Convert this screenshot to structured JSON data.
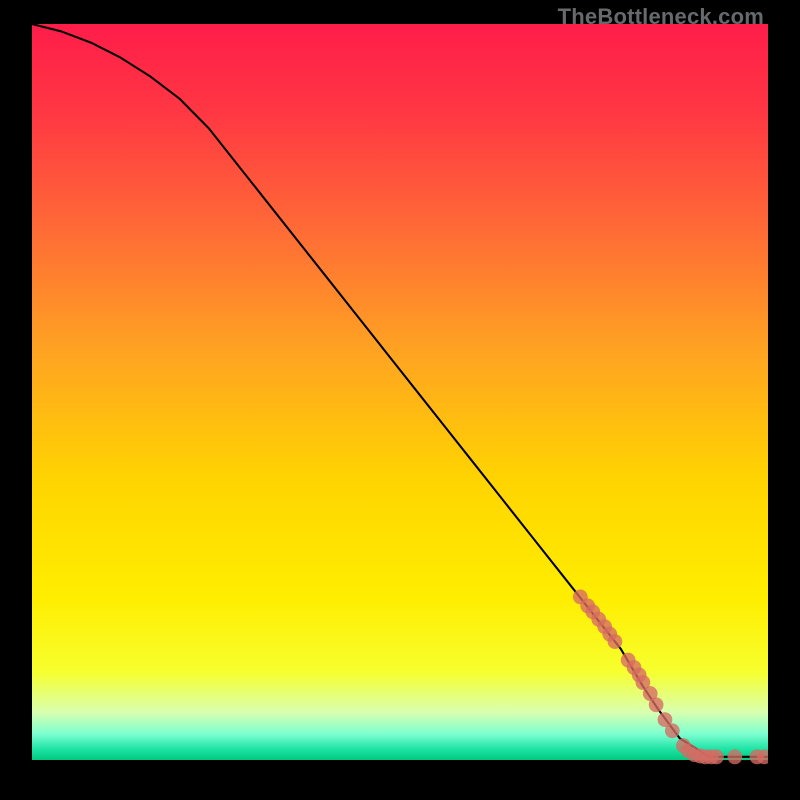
{
  "watermark": "TheBottleneck.com",
  "colors": {
    "dot": "#d66a63",
    "curve": "#000000",
    "gradient_stops": [
      {
        "offset": 0.0,
        "color": "#ff1d4a"
      },
      {
        "offset": 0.12,
        "color": "#ff3743"
      },
      {
        "offset": 0.28,
        "color": "#ff6b36"
      },
      {
        "offset": 0.45,
        "color": "#ffa521"
      },
      {
        "offset": 0.62,
        "color": "#ffd400"
      },
      {
        "offset": 0.78,
        "color": "#ffee00"
      },
      {
        "offset": 0.88,
        "color": "#f7ff2e"
      },
      {
        "offset": 0.935,
        "color": "#d9ffb0"
      },
      {
        "offset": 0.965,
        "color": "#7cffd0"
      },
      {
        "offset": 0.985,
        "color": "#1ee3a5"
      },
      {
        "offset": 1.0,
        "color": "#00c97e"
      }
    ]
  },
  "chart_data": {
    "type": "line",
    "title": "",
    "xlabel": "",
    "ylabel": "",
    "xlim": [
      0,
      100
    ],
    "ylim": [
      0,
      100
    ],
    "series": [
      {
        "name": "curve",
        "x": [
          0,
          4,
          8,
          12,
          16,
          20,
          24,
          28,
          32,
          36,
          40,
          44,
          48,
          52,
          56,
          60,
          64,
          68,
          72,
          76,
          80,
          83,
          85,
          88,
          92,
          96,
          100
        ],
        "y": [
          100,
          99,
          97.5,
          95.5,
          93,
          90,
          86,
          81,
          76,
          71,
          66,
          61,
          56,
          51,
          46,
          41,
          36,
          31,
          26,
          21,
          16,
          11,
          8,
          4,
          1.5,
          1.5,
          1.5
        ]
      }
    ],
    "markers": [
      {
        "x": 74.5,
        "y": 23,
        "r": 1.0
      },
      {
        "x": 75.5,
        "y": 21.8,
        "r": 1.0
      },
      {
        "x": 76.2,
        "y": 21,
        "r": 1.0
      },
      {
        "x": 77.0,
        "y": 20,
        "r": 1.0
      },
      {
        "x": 77.8,
        "y": 19,
        "r": 1.0
      },
      {
        "x": 78.5,
        "y": 18,
        "r": 1.0
      },
      {
        "x": 79.2,
        "y": 17,
        "r": 1.0
      },
      {
        "x": 81.0,
        "y": 14.5,
        "r": 1.0
      },
      {
        "x": 81.8,
        "y": 13.5,
        "r": 1.0
      },
      {
        "x": 82.5,
        "y": 12.5,
        "r": 1.0
      },
      {
        "x": 83.0,
        "y": 11.5,
        "r": 1.0
      },
      {
        "x": 84.0,
        "y": 10,
        "r": 1.0
      },
      {
        "x": 84.8,
        "y": 8.5,
        "r": 1.0
      },
      {
        "x": 86.0,
        "y": 6.5,
        "r": 1.0
      },
      {
        "x": 87.0,
        "y": 5,
        "r": 1.0
      },
      {
        "x": 88.5,
        "y": 3,
        "r": 1.0
      },
      {
        "x": 89.2,
        "y": 2.3,
        "r": 1.0
      },
      {
        "x": 90.0,
        "y": 1.8,
        "r": 1.0
      },
      {
        "x": 90.8,
        "y": 1.6,
        "r": 1.0
      },
      {
        "x": 91.5,
        "y": 1.5,
        "r": 1.0
      },
      {
        "x": 92.3,
        "y": 1.5,
        "r": 1.0
      },
      {
        "x": 93.0,
        "y": 1.5,
        "r": 1.0
      },
      {
        "x": 95.5,
        "y": 1.5,
        "r": 1.0
      },
      {
        "x": 98.5,
        "y": 1.5,
        "r": 1.0
      },
      {
        "x": 99.5,
        "y": 1.5,
        "r": 1.0
      }
    ]
  }
}
